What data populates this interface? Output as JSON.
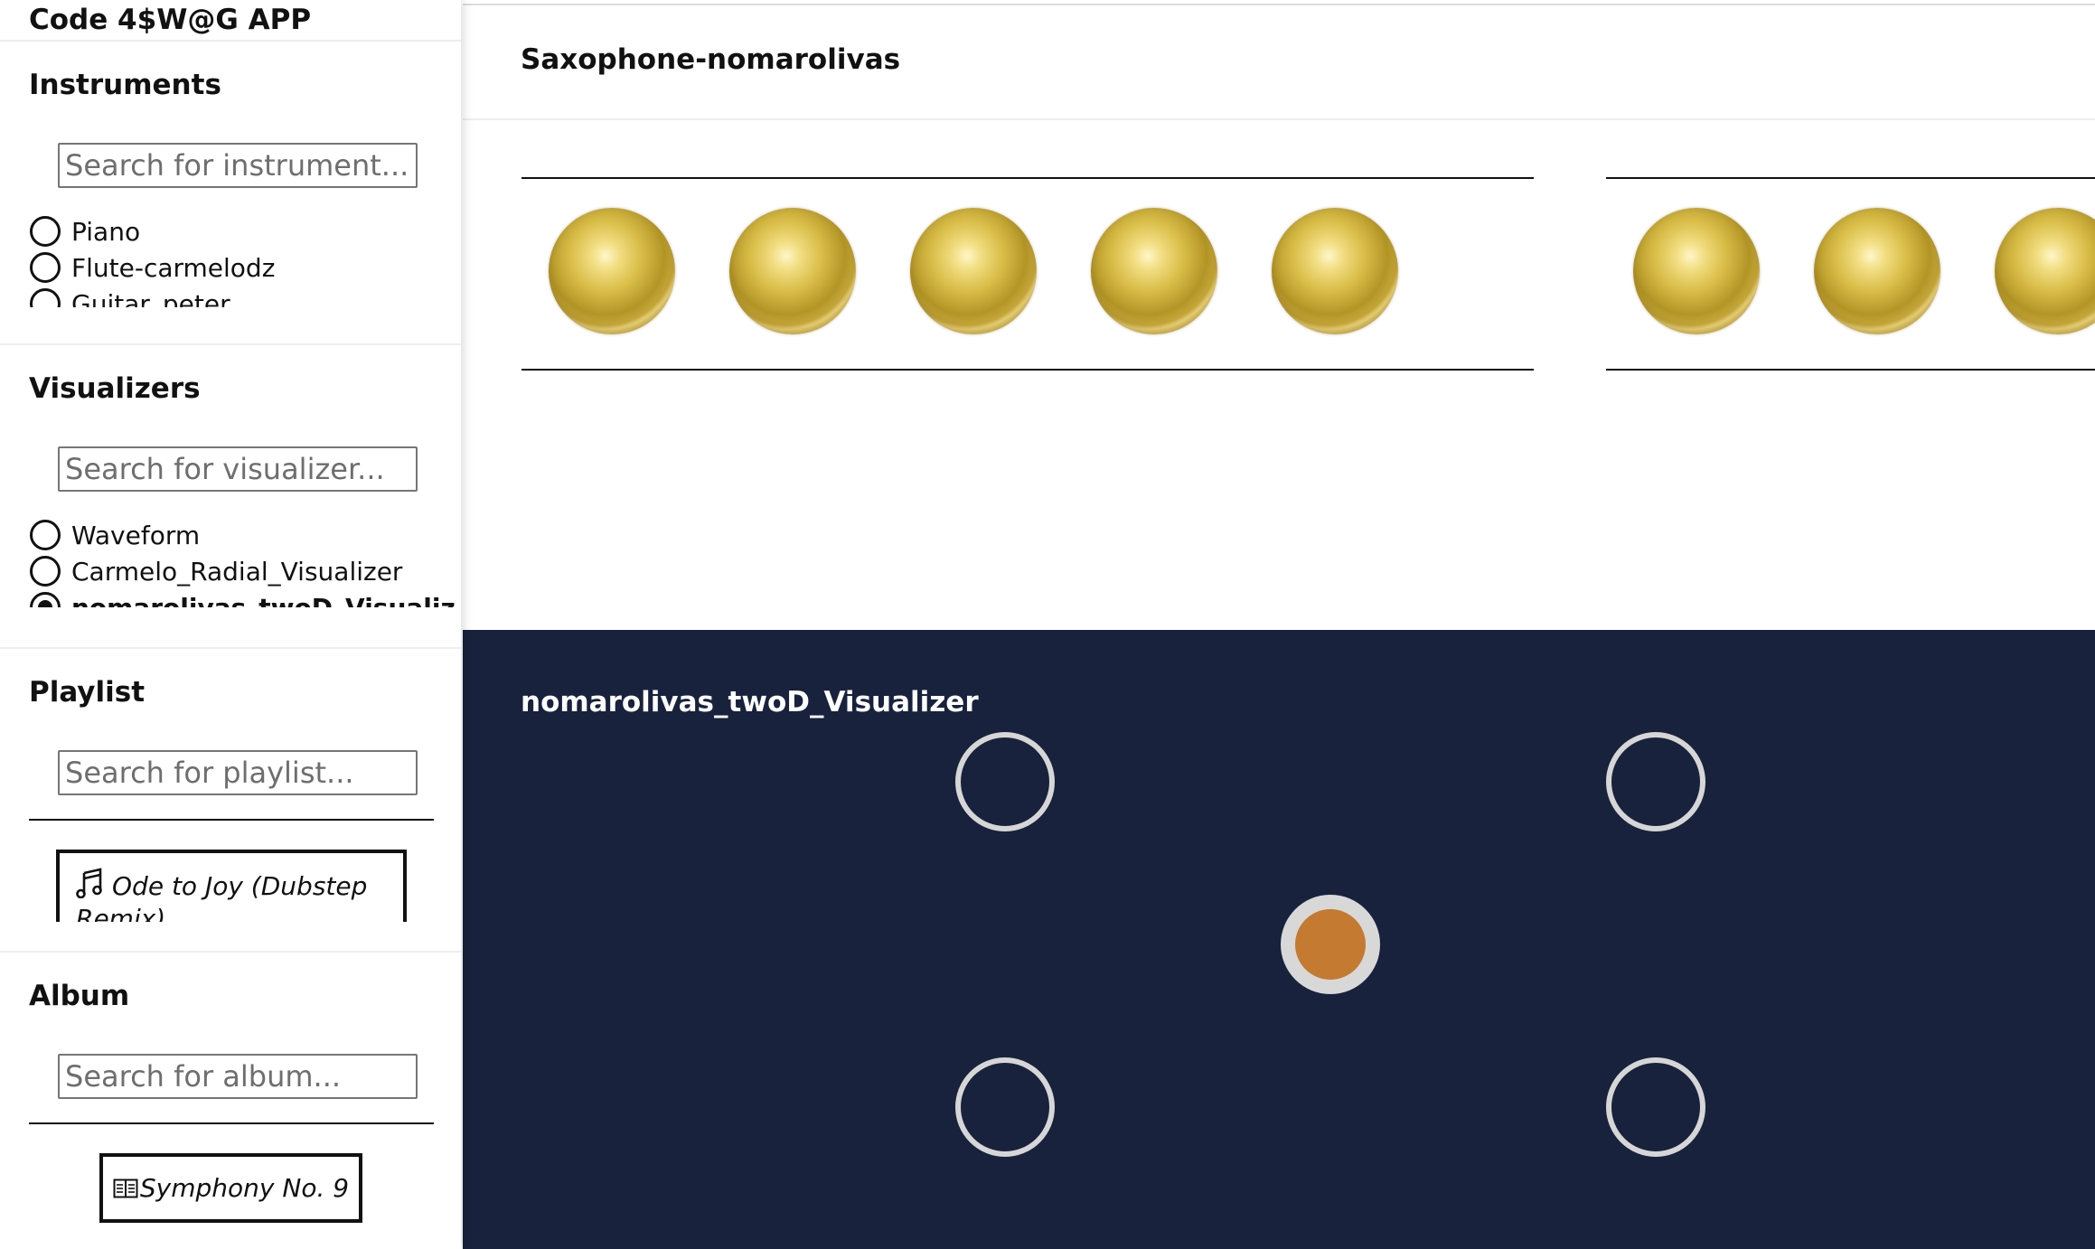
{
  "app": {
    "title": "Code 4$W@G APP"
  },
  "sidebar": {
    "instruments": {
      "heading": "Instruments",
      "search_placeholder": "Search for instrument...",
      "items": [
        {
          "label": "Piano",
          "selected": false
        },
        {
          "label": "Flute-carmelodz",
          "selected": false
        },
        {
          "label": "Guitar_peter",
          "selected": false
        }
      ]
    },
    "visualizers": {
      "heading": "Visualizers",
      "search_placeholder": "Search for visualizer...",
      "items": [
        {
          "label": "Waveform",
          "selected": false
        },
        {
          "label": "Carmelo_Radial_Visualizer",
          "selected": false
        },
        {
          "label": "nomarolivas_twoD_Visualizer",
          "selected": true
        }
      ]
    },
    "playlist": {
      "heading": "Playlist",
      "search_placeholder": "Search for playlist...",
      "songs": [
        {
          "title": "Ode to Joy (Dubstep Remix)",
          "icon": "music-note-icon"
        }
      ]
    },
    "album": {
      "heading": "Album",
      "search_placeholder": "Search for album...",
      "albums": [
        {
          "title": "Symphony No. 9",
          "icon": "album-icon"
        }
      ]
    }
  },
  "main": {
    "instrument_title": "Saxophone-nomarolivas",
    "key_groups": [
      {
        "keys": 5
      },
      {
        "keys": 3
      }
    ],
    "visualizer": {
      "title": "nomarolivas_twoD_Visualizer",
      "background_color": "#18223d",
      "ring_color": "#d6d6d6",
      "center_color": "#c47a30"
    }
  }
}
